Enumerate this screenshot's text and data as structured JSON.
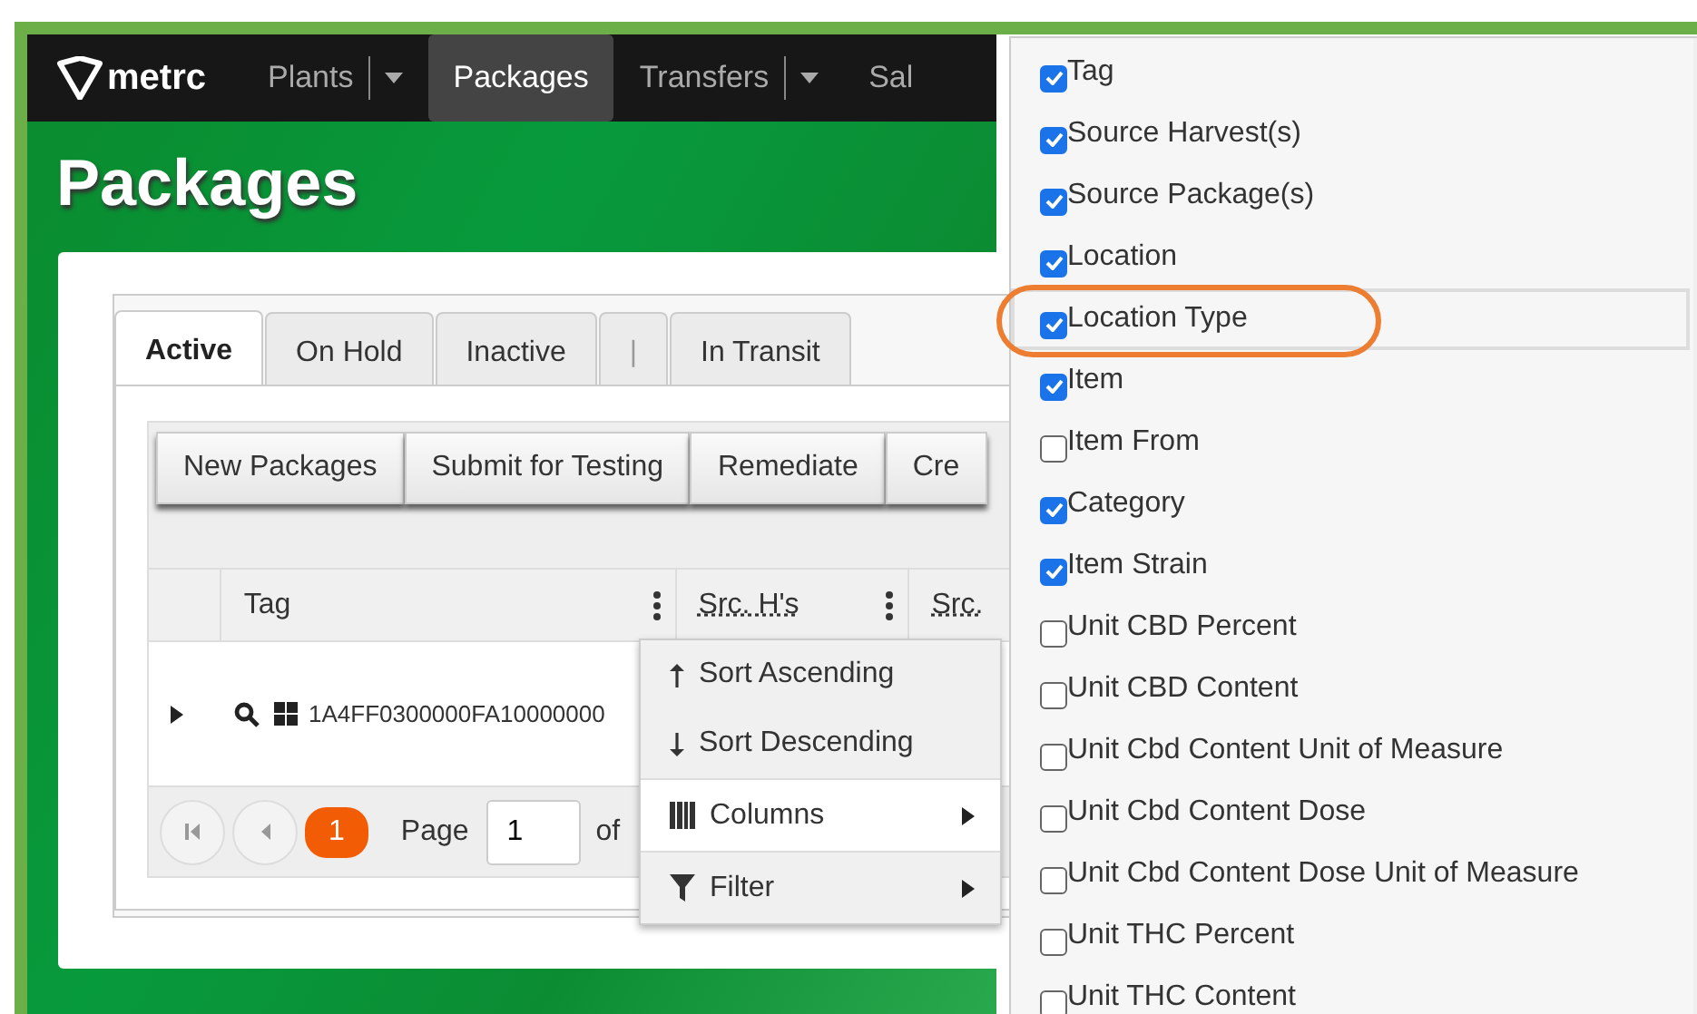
{
  "nav": {
    "logo": "metrc",
    "items": [
      {
        "label": "Plants",
        "dropdown": true,
        "selected": false
      },
      {
        "label": "Packages",
        "dropdown": false,
        "selected": true
      },
      {
        "label": "Transfers",
        "dropdown": true,
        "selected": false
      },
      {
        "label": "Sal",
        "dropdown": false,
        "selected": false
      }
    ]
  },
  "page_title": "Packages",
  "tabs": [
    {
      "kind": "tab",
      "label": "Active",
      "selected": true
    },
    {
      "kind": "tab",
      "label": "On Hold",
      "selected": false
    },
    {
      "kind": "tab",
      "label": "Inactive",
      "selected": false
    },
    {
      "kind": "separator",
      "label": "|",
      "selected": false
    },
    {
      "kind": "tab",
      "label": "In Transit",
      "selected": false
    }
  ],
  "toolbar_buttons": [
    "New Packages",
    "Submit for Testing",
    "Remediate",
    "Cre"
  ],
  "table": {
    "columns": [
      {
        "label": "Tag",
        "menu": true
      },
      {
        "label": "Src. H's",
        "menu": true
      },
      {
        "label": "Src.",
        "menu": false
      }
    ],
    "rows": [
      {
        "tag": "1A4FF0300000FA10000000",
        "expanded": false
      }
    ]
  },
  "pager": {
    "current": "1",
    "page_label": "Page",
    "page_value": "1",
    "of_label": "of"
  },
  "column_menu": {
    "items": [
      {
        "kind": "sort_asc",
        "label": "Sort Ascending",
        "selected": false
      },
      {
        "kind": "sort_desc",
        "label": "Sort Descending",
        "selected": false
      },
      {
        "kind": "columns",
        "label": "Columns",
        "selected": true
      },
      {
        "kind": "filter",
        "label": "Filter",
        "selected": false
      }
    ]
  },
  "columns_list": {
    "items": [
      {
        "label": "Tag",
        "checked": true,
        "selected": false,
        "circled": false
      },
      {
        "label": "Source Harvest(s)",
        "checked": true,
        "selected": false,
        "circled": false
      },
      {
        "label": "Source Package(s)",
        "checked": true,
        "selected": false,
        "circled": false
      },
      {
        "label": "Location",
        "checked": true,
        "selected": false,
        "circled": false
      },
      {
        "label": "Location Type",
        "checked": true,
        "selected": true,
        "circled": true
      },
      {
        "label": "Item",
        "checked": true,
        "selected": false,
        "circled": false
      },
      {
        "label": "Item From",
        "checked": false,
        "selected": false,
        "circled": false
      },
      {
        "label": "Category",
        "checked": true,
        "selected": false,
        "circled": false
      },
      {
        "label": "Item Strain",
        "checked": true,
        "selected": false,
        "circled": false
      },
      {
        "label": "Unit CBD Percent",
        "checked": false,
        "selected": false,
        "circled": false
      },
      {
        "label": "Unit CBD Content",
        "checked": false,
        "selected": false,
        "circled": false
      },
      {
        "label": "Unit Cbd Content Unit of Measure",
        "checked": false,
        "selected": false,
        "circled": false
      },
      {
        "label": "Unit Cbd Content Dose",
        "checked": false,
        "selected": false,
        "circled": false
      },
      {
        "label": "Unit Cbd Content Dose Unit of Measure",
        "checked": false,
        "selected": false,
        "circled": false
      },
      {
        "label": "Unit THC Percent",
        "checked": false,
        "selected": false,
        "circled": false
      },
      {
        "label": "Unit THC Content",
        "checked": false,
        "selected": false,
        "circled": false
      }
    ]
  }
}
